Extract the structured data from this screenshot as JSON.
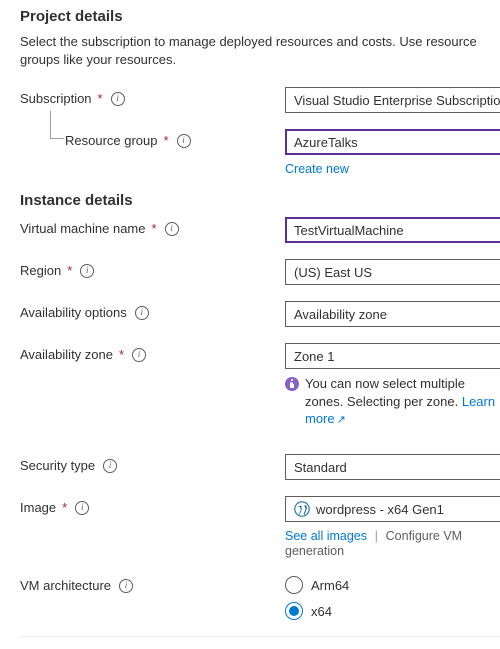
{
  "project": {
    "title": "Project details",
    "description": "Select the subscription to manage deployed resources and costs. Use resource groups like your resources.",
    "subscription": {
      "label": "Subscription",
      "value": "Visual Studio Enterprise Subscription"
    },
    "resource_group": {
      "label": "Resource group",
      "value": "AzureTalks",
      "create_new": "Create new"
    }
  },
  "instance": {
    "title": "Instance details",
    "vm_name": {
      "label": "Virtual machine name",
      "value": "TestVirtualMachine"
    },
    "region": {
      "label": "Region",
      "value": "(US) East US"
    },
    "avail_options": {
      "label": "Availability options",
      "value": "Availability zone"
    },
    "avail_zone": {
      "label": "Availability zone",
      "value": "Zone 1",
      "callout": "You can now select multiple zones. Selecting per zone.",
      "learn_more": "Learn more"
    },
    "security_type": {
      "label": "Security type",
      "value": "Standard"
    },
    "image": {
      "label": "Image",
      "value": "wordpress - x64 Gen1",
      "see_all": "See all images",
      "configure": "Configure VM generation"
    },
    "vm_arch": {
      "label": "VM architecture",
      "options": [
        "Arm64",
        "x64"
      ],
      "selected": "x64"
    }
  }
}
